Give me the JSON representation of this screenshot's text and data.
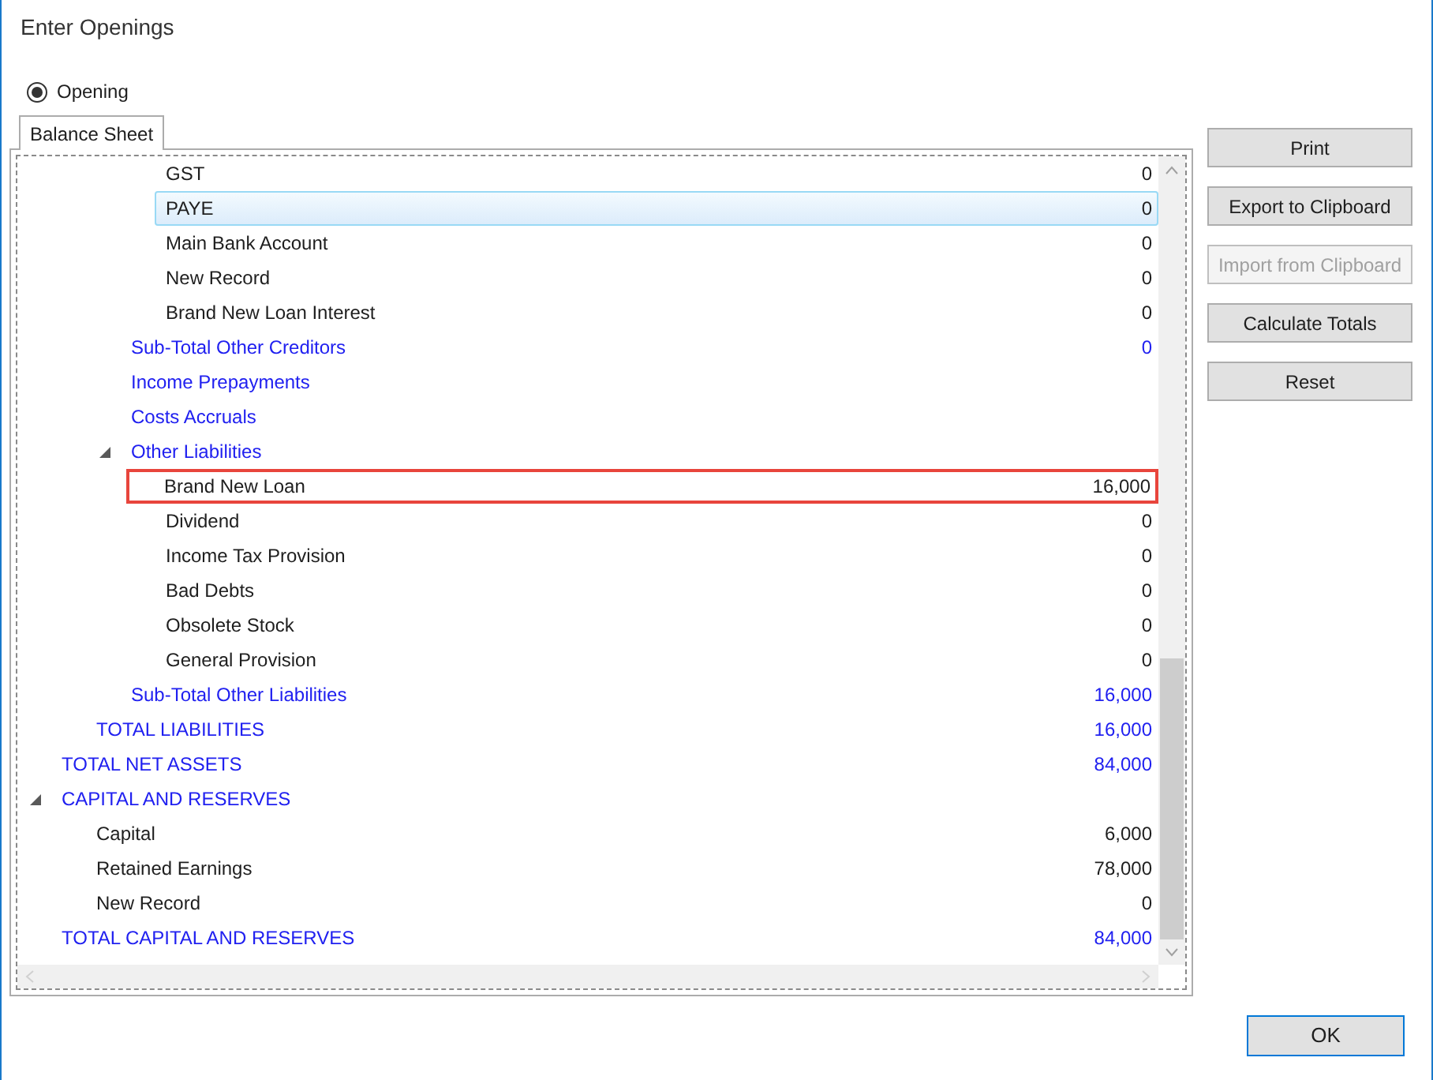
{
  "window": {
    "title": "Enter Openings"
  },
  "mode_options": [
    {
      "label": "Opening",
      "selected": true
    }
  ],
  "tabs": [
    {
      "label": "Balance Sheet",
      "selected": true
    }
  ],
  "tree": [
    {
      "children": [
        {
          "children": [
            {
              "children": [
                {
                  "kind": "account",
                  "label": "GST",
                  "value": "0",
                  "selected": false,
                  "highlighted": false
                },
                {
                  "kind": "account",
                  "label": "PAYE",
                  "value": "0",
                  "selected": true,
                  "highlighted": false
                },
                {
                  "kind": "account",
                  "label": "Main Bank Account",
                  "value": "0",
                  "selected": false,
                  "highlighted": false
                },
                {
                  "kind": "account",
                  "label": "New Record",
                  "value": "0",
                  "selected": false,
                  "highlighted": false
                },
                {
                  "kind": "account",
                  "label": "Brand New Loan Interest",
                  "value": "0",
                  "selected": false,
                  "highlighted": false
                }
              ]
            },
            {
              "kind": "total",
              "label": "Sub-Total Other Creditors",
              "value": "0",
              "selected": false,
              "highlighted": false
            },
            {
              "kind": "total",
              "label": "Income Prepayments",
              "selected": false,
              "highlighted": false
            },
            {
              "kind": "total",
              "label": "Costs Accruals",
              "selected": false,
              "highlighted": false
            },
            {
              "kind": "total",
              "label": "Other Liabilities",
              "selected": false,
              "highlighted": false,
              "expanded": true,
              "children": [
                {
                  "kind": "account",
                  "label": "Brand New Loan",
                  "value": "16,000",
                  "selected": false,
                  "highlighted": true
                },
                {
                  "kind": "account",
                  "label": "Dividend",
                  "value": "0",
                  "selected": false,
                  "highlighted": false
                },
                {
                  "kind": "account",
                  "label": "Income Tax Provision",
                  "value": "0",
                  "selected": false,
                  "highlighted": false
                },
                {
                  "kind": "account",
                  "label": "Bad Debts",
                  "value": "0",
                  "selected": false,
                  "highlighted": false
                },
                {
                  "kind": "account",
                  "label": "Obsolete Stock",
                  "value": "0",
                  "selected": false,
                  "highlighted": false
                },
                {
                  "kind": "account",
                  "label": "General Provision",
                  "value": "0",
                  "selected": false,
                  "highlighted": false
                }
              ]
            },
            {
              "kind": "total",
              "label": "Sub-Total Other Liabilities",
              "value": "16,000",
              "selected": false,
              "highlighted": false
            }
          ]
        },
        {
          "kind": "total",
          "label": "TOTAL LIABILITIES",
          "value": "16,000",
          "selected": false,
          "highlighted": false
        }
      ]
    },
    {
      "kind": "total",
      "label": "TOTAL NET ASSETS",
      "value": "84,000",
      "selected": false,
      "highlighted": false
    },
    {
      "kind": "total",
      "label": "CAPITAL AND RESERVES",
      "selected": false,
      "highlighted": false,
      "expanded": true,
      "children": [
        {
          "kind": "account",
          "label": "Capital",
          "value": "6,000",
          "selected": false,
          "highlighted": false
        },
        {
          "kind": "account",
          "label": "Retained Earnings",
          "value": "78,000",
          "selected": false,
          "highlighted": false
        },
        {
          "kind": "account",
          "label": "New Record",
          "value": "0",
          "selected": false,
          "highlighted": false
        }
      ]
    },
    {
      "kind": "total",
      "label": "TOTAL CAPITAL AND RESERVES",
      "value": "84,000",
      "selected": false,
      "highlighted": false
    }
  ],
  "actions": [
    {
      "label": "Print",
      "disabled": false
    },
    {
      "label": "Export to Clipboard",
      "disabled": false
    },
    {
      "label": "Import from Clipboard",
      "disabled": true
    },
    {
      "label": "Calculate Totals",
      "disabled": false
    },
    {
      "label": "Reset",
      "disabled": false
    }
  ],
  "footer_buttons": [
    {
      "label": "OK"
    }
  ]
}
